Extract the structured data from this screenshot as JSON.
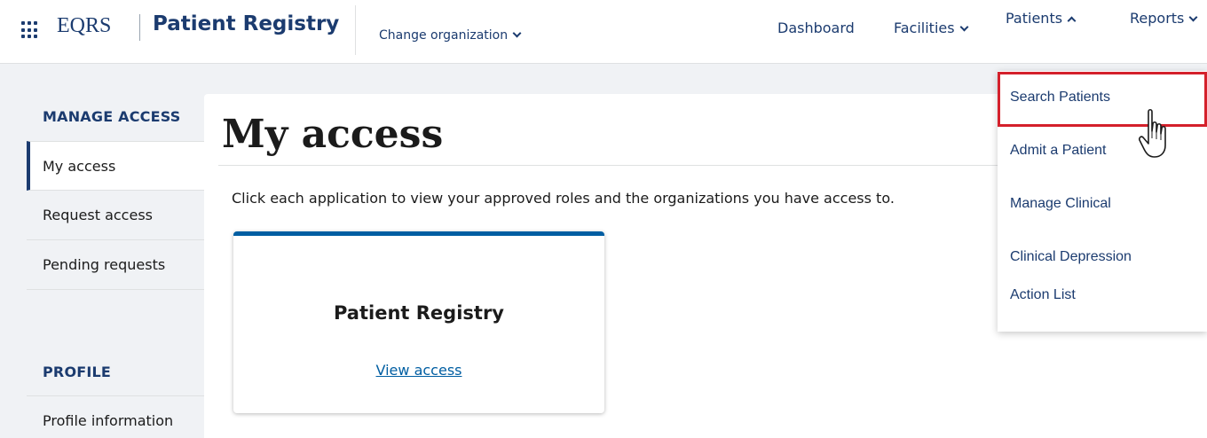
{
  "header": {
    "brand_short": "EQRS",
    "brand_app": "Patient Registry",
    "change_org_label": "Change organization",
    "nav": [
      {
        "label": "Dashboard",
        "has_chevron": false
      },
      {
        "label": "Facilities",
        "has_chevron": true,
        "chevron": "chevron-down-icon"
      },
      {
        "label": "Patients",
        "has_chevron": true,
        "chevron": "chevron-up-icon"
      },
      {
        "label": "Reports",
        "has_chevron": true,
        "chevron": "chevron-down-icon"
      }
    ]
  },
  "sidebar": {
    "manage_access_heading": "MANAGE ACCESS",
    "manage_items": [
      {
        "label": "My access",
        "active": true
      },
      {
        "label": "Request access",
        "active": false
      },
      {
        "label": "Pending requests",
        "active": false
      }
    ],
    "profile_heading": "PROFILE",
    "profile_items": [
      {
        "label": "Profile information",
        "active": false
      }
    ]
  },
  "main": {
    "title": "My access",
    "intro": "Click each application to view your approved roles and the organizations you have access to.",
    "cards": [
      {
        "title": "Patient Registry",
        "link_label": "View access"
      }
    ]
  },
  "patients_dropdown": {
    "items": [
      "Search Patients",
      "Admit a Patient",
      "Manage Clinical",
      "Clinical Depression",
      "Action List"
    ],
    "highlighted_item": "Search Patients"
  },
  "colors": {
    "brand_navy": "#1b3b6f",
    "link_blue": "#005ea2",
    "highlight_red": "#d4202b",
    "page_bg": "#f0f2f5"
  }
}
